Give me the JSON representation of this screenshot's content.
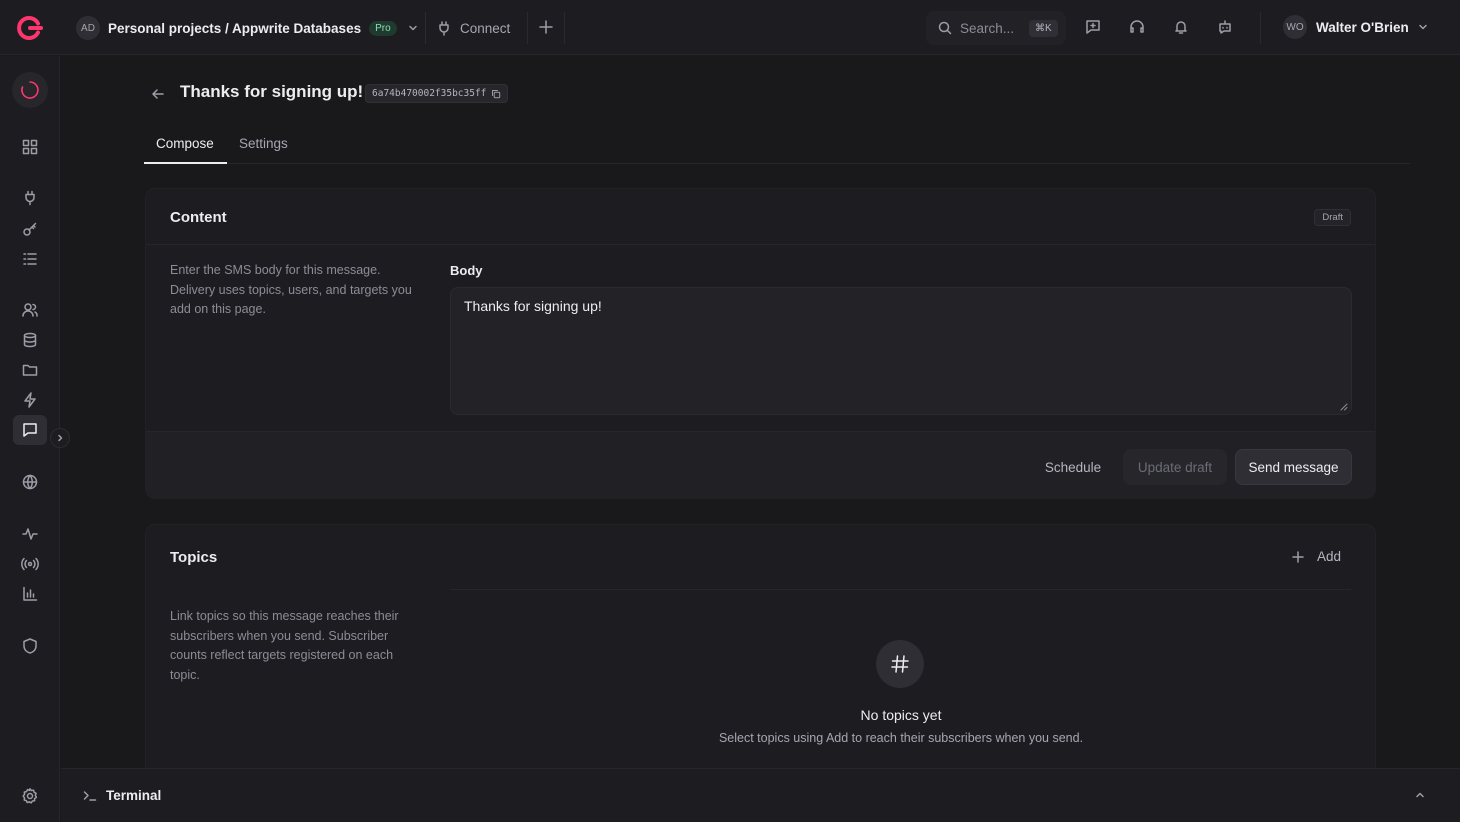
{
  "header": {
    "project_initials": "AD",
    "project_name": "Personal projects / Appwrite Databases",
    "plan_badge": "Pro",
    "connect_label": "Connect",
    "search_placeholder": "Search...",
    "search_shortcut": "⌘K",
    "user_initials": "WO",
    "user_name": "Walter O'Brien"
  },
  "page": {
    "title": "Thanks for signing up!",
    "message_id": "6a74b470002f35bc35ff",
    "tabs": [
      {
        "label": "Compose",
        "active": true
      },
      {
        "label": "Settings",
        "active": false
      }
    ]
  },
  "content_card": {
    "title": "Content",
    "status_badge": "Draft",
    "description": "Enter the SMS body for this message. Delivery uses topics, users, and targets you add on this page.",
    "body_label": "Body",
    "body_value": "Thanks for signing up!",
    "buttons": {
      "schedule": "Schedule",
      "update_draft": "Update draft",
      "send": "Send message"
    }
  },
  "topics_card": {
    "title": "Topics",
    "add_label": "Add",
    "description": "Link topics so this message reaches their subscribers when you send. Subscriber counts reflect targets registered on each topic.",
    "empty_title": "No topics yet",
    "empty_subtitle": "Select topics using Add to reach their subscribers when you send."
  },
  "terminal": {
    "label": "Terminal"
  },
  "colors": {
    "background": "#19191c",
    "surface": "#1d1d21",
    "accent": "#fd366e",
    "pro_badge": "#8ddfb5"
  }
}
